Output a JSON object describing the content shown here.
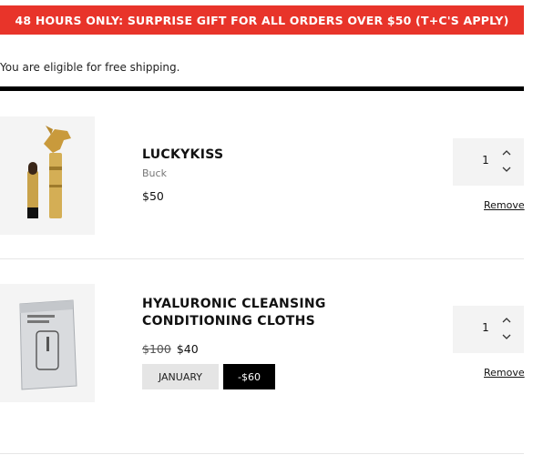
{
  "promo_banner": "48 HOURS ONLY: SURPRISE GIFT FOR ALL ORDERS OVER $50 (T+C'S APPLY)",
  "shipping_message": "You are eligible for free shipping.",
  "items": [
    {
      "name": "LUCKYKISS",
      "variant": "Buck",
      "price": "$50",
      "quantity": "1",
      "remove_label": "Remove",
      "image": "lipstick-horse-image"
    },
    {
      "name": "HYALURONIC CLEANSING CONDITIONING CLOTHS",
      "original_price": "$100",
      "price": "$40",
      "promo_tag": "JANUARY",
      "discount_tag": "-$60",
      "quantity": "1",
      "remove_label": "Remove",
      "image": "cleansing-cloths-pack-image"
    }
  ],
  "colors": {
    "banner": "#e8342a",
    "qty_background": "#f3f3f3",
    "promo_tag_background": "#e5e5e5",
    "discount_tag_background": "#000000"
  }
}
